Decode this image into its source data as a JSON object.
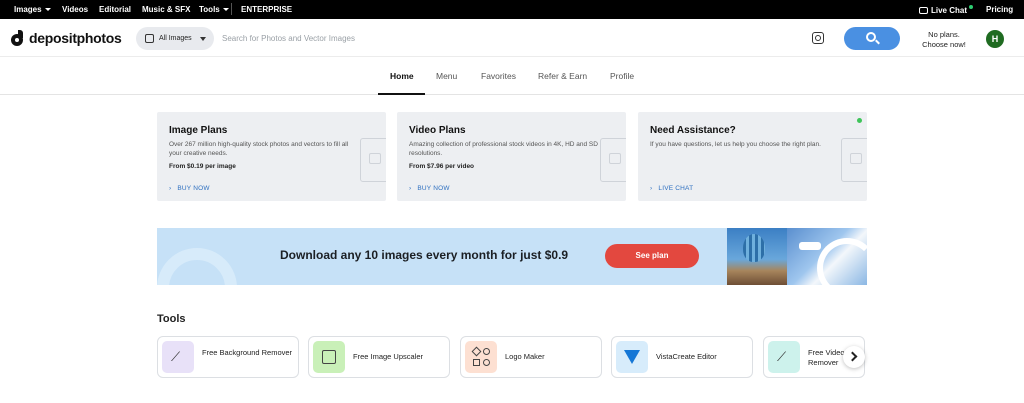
{
  "topbar": {
    "images": "Images",
    "videos": "Videos",
    "editorial": "Editorial",
    "music": "Music & SFX",
    "tools": "Tools",
    "enterprise": "ENTERPRISE",
    "live_chat": "Live Chat",
    "pricing": "Pricing"
  },
  "header": {
    "logo": "depositphotos",
    "filter_label": "All Images",
    "search_placeholder": "Search for Photos and Vector Images",
    "plans_line1": "No plans.",
    "plans_line2": "Choose now!",
    "avatar_letter": "H"
  },
  "nav": {
    "tabs": [
      "Home",
      "Menu",
      "Favorites",
      "Refer & Earn",
      "Profile"
    ]
  },
  "cards": [
    {
      "title": "Image Plans",
      "desc": "Over 267 million high-quality stock photos and vectors to fill all your creative needs.",
      "price": "From $0.19 per image",
      "link": "BUY NOW"
    },
    {
      "title": "Video Plans",
      "desc": "Amazing collection of professional stock videos in 4K, HD and SD resolutions.",
      "price": "From $7.96 per video",
      "link": "BUY NOW"
    },
    {
      "title": "Need Assistance?",
      "desc": "If you have questions, let us help you choose the right plan.",
      "link": "LIVE CHAT"
    }
  ],
  "banner": {
    "text": "Download any 10 images every month for just $0.9",
    "button": "See plan"
  },
  "tools": {
    "title": "Tools",
    "items": [
      {
        "label": "Free Background Remover",
        "icon": "magic-wand-icon"
      },
      {
        "label": "Free Image Upscaler",
        "icon": "image-upscale-icon"
      },
      {
        "label": "Logo Maker",
        "icon": "shapes-icon"
      },
      {
        "label": "VistaCreate Editor",
        "icon": "vistacreate-icon"
      },
      {
        "label": "Free Video Remover",
        "icon": "magic-wand-icon"
      }
    ]
  },
  "colors": {
    "accent_blue": "#4a90e2",
    "cta_red": "#e3483f",
    "avatar_green": "#1f6b21",
    "banner_bg": "#c6e1f7"
  }
}
